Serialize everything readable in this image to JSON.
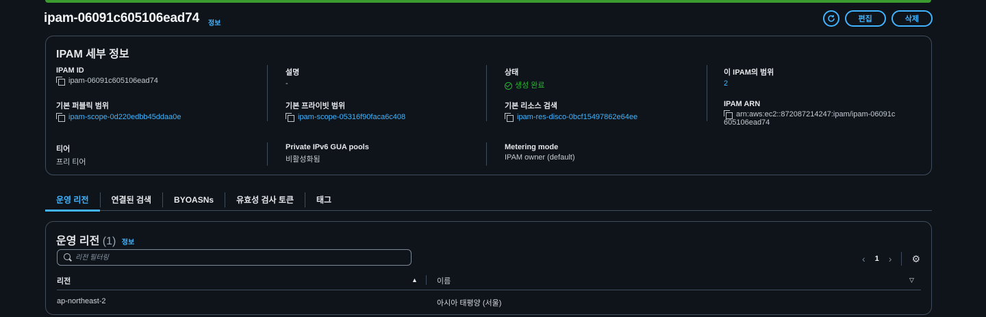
{
  "header": {
    "title": "ipam-06091c605106ead74",
    "info": "정보",
    "edit_label": "편집",
    "delete_label": "삭제"
  },
  "details": {
    "heading": "IPAM 세부 정보",
    "ipam_id": {
      "label": "IPAM ID",
      "value": "ipam-06091c605106ead74"
    },
    "description": {
      "label": "설명",
      "value": "-"
    },
    "status": {
      "label": "상태",
      "value": "생성 완료"
    },
    "scopes": {
      "label": "이 IPAM의 범위",
      "value": "2"
    },
    "public_scope": {
      "label": "기본 퍼블릭 범위",
      "value": "ipam-scope-0d220edbb45ddaa0e"
    },
    "private_scope": {
      "label": "기본 프라이빗 범위",
      "value": "ipam-scope-05316f90faca6c408"
    },
    "resource_discovery": {
      "label": "기본 리소스 검색",
      "value": "ipam-res-disco-0bcf15497862e64ee"
    },
    "arn": {
      "label": "IPAM ARN",
      "value_line1": "arn:aws:ec2::872087214247:ipam/ipam-06091c",
      "value_line2": "605106ead74"
    },
    "tier": {
      "label": "티어",
      "value": "프리 티어"
    },
    "ipv6_gua": {
      "label": "Private IPv6 GUA pools",
      "value": "비활성화됨"
    },
    "metering": {
      "label": "Metering mode",
      "value": "IPAM owner (default)"
    }
  },
  "tabs": [
    "운영 리전",
    "연결된 검색",
    "BYOASNs",
    "유효성 검사 토큰",
    "태그"
  ],
  "regions": {
    "heading": "운영 리전",
    "count": "(1)",
    "info": "정보",
    "search_placeholder": "리전 필터링",
    "page": "1",
    "col_region": "리전",
    "col_name": "이름",
    "rows": [
      {
        "region": "ap-northeast-2",
        "name": "아시아 태평양 (서울)"
      }
    ]
  }
}
